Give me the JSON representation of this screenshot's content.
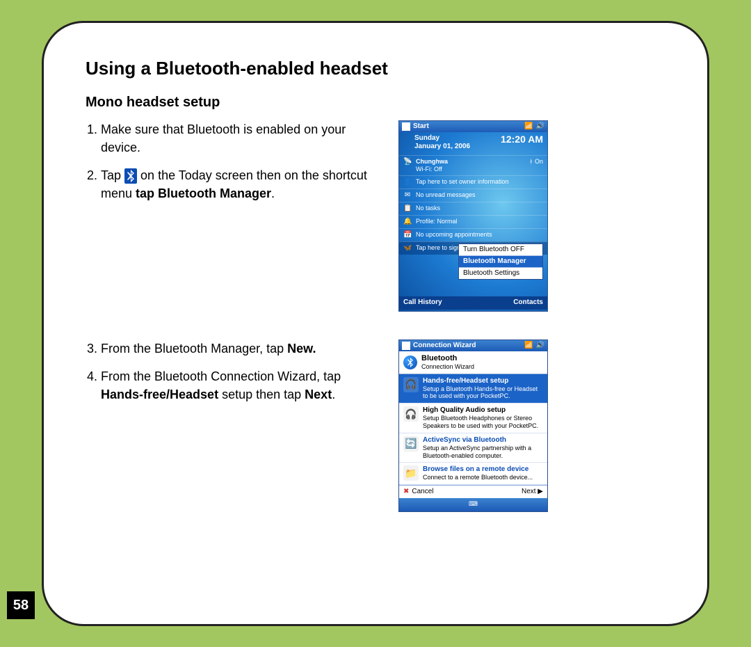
{
  "page_number": "58",
  "heading": "Using a Bluetooth-enabled headset",
  "subheading": "Mono headset setup",
  "steps_block1": {
    "s1": "Make sure that Bluetooth is enabled on your device.",
    "s2_a": "Tap ",
    "s2_b": " on the Today screen then on the shortcut menu ",
    "s2_bold": "tap Bluetooth Manager",
    "s2_c": "."
  },
  "steps_block2": {
    "s3_a": "From the Bluetooth Manager, tap ",
    "s3_bold": "New.",
    "s4_a": "From the Bluetooth Connection Wizard, tap ",
    "s4_bold1": "Hands-free/Headset",
    "s4_mid": " setup then tap ",
    "s4_bold2": "Next",
    "s4_end": "."
  },
  "shot1": {
    "titlebar_label": "Start",
    "date_day": "Sunday",
    "date_full": "January 01, 2006",
    "time": "12:20 AM",
    "carrier": "Chunghwa",
    "wifi": "Wi-Fi: Off",
    "bt_state": "On",
    "rows": {
      "owner": "Tap here to set owner information",
      "msgs": "No unread messages",
      "tasks": "No tasks",
      "profile": "Profile: Normal",
      "appts": "No upcoming appointments",
      "msn": "Tap here to sign in to Pocket MSN!"
    },
    "popup": {
      "off": "Turn Bluetooth OFF",
      "manager": "Bluetooth Manager",
      "settings": "Bluetooth Settings"
    },
    "bottom_left": "Call History",
    "bottom_right": "Contacts"
  },
  "shot2": {
    "titlebar_label": "Connection Wizard",
    "header_title": "Bluetooth",
    "header_sub": "Connection Wizard",
    "items": {
      "hf_title": "Hands-free/Headset setup",
      "hf_desc": "Setup a Bluetooth Hands-free or Headset to be used with your PocketPC.",
      "hq_title": "High Quality Audio setup",
      "hq_desc": "Setup Bluetooth Headphones or Stereo Speakers to be used with your PocketPC.",
      "as_title": "ActiveSync via Bluetooth",
      "as_desc": "Setup an ActiveSync partnership with a Bluetooth-enabled computer.",
      "br_title": "Browse files on a remote device",
      "br_desc": "Connect to a remote Bluetooth device..."
    },
    "cancel": "Cancel",
    "next": "Next"
  }
}
